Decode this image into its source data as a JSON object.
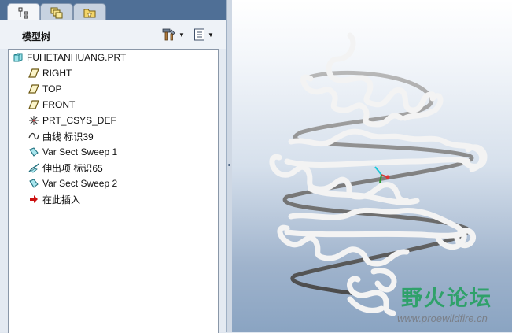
{
  "tabs": [
    {
      "name": "model-tree",
      "active": true
    },
    {
      "name": "layers",
      "active": false
    },
    {
      "name": "favorites",
      "active": false
    }
  ],
  "panel": {
    "title": "模型树",
    "settings_tool": "hammer-icon",
    "show_tool": "tree-columns-icon"
  },
  "tree": {
    "root": "FUHETANHUANG.PRT",
    "items": [
      {
        "label": "RIGHT",
        "icon": "datum-plane-icon"
      },
      {
        "label": "TOP",
        "icon": "datum-plane-icon"
      },
      {
        "label": "FRONT",
        "icon": "datum-plane-icon"
      },
      {
        "label": "PRT_CSYS_DEF",
        "icon": "csys-icon"
      },
      {
        "label": "曲线 标识39",
        "icon": "curve-icon"
      },
      {
        "label": "Var Sect Sweep 1",
        "icon": "sweep-icon"
      },
      {
        "label": "伸出项 标识65",
        "icon": "protrusion-icon"
      },
      {
        "label": "Var Sect Sweep 2",
        "icon": "sweep-icon"
      },
      {
        "label": "在此插入",
        "icon": "insert-arrow-icon"
      }
    ]
  },
  "colors": {
    "tab_bar": "#4f6f96",
    "spring_coil": "#f2f2f2",
    "core_wire": "#8c8c8c",
    "insert_arrow": "#cc1111",
    "watermark": "#2fa16a"
  },
  "watermark": {
    "title": "野火论坛",
    "url": "www.proewildfire.cn"
  }
}
